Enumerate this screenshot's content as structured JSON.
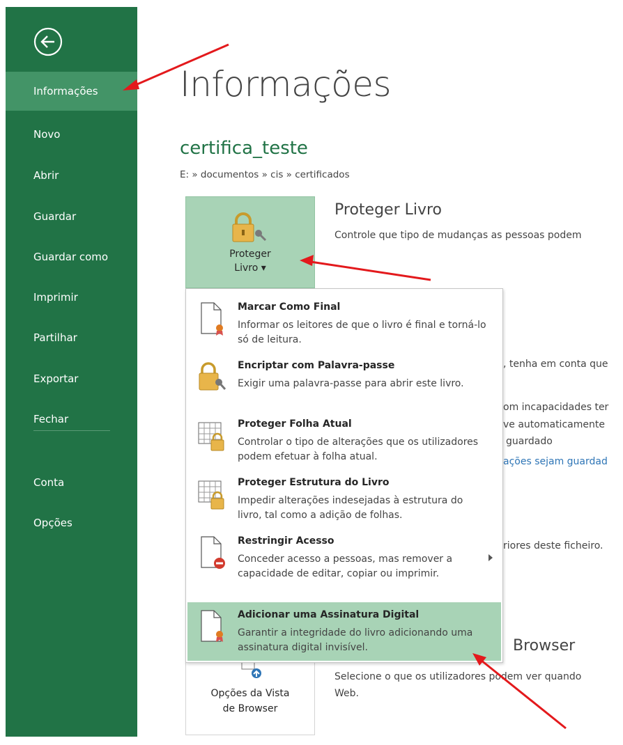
{
  "colors": {
    "sidebar": "#217346",
    "sidebar_selected": "#439467",
    "accent_green": "#217346",
    "highlight": "#a8d3b6",
    "link": "#2e75b6",
    "annotation_arrow": "#e3191c"
  },
  "sidebar": {
    "back_icon": "back-arrow-circle-icon",
    "items": [
      {
        "label": "Informações",
        "selected": true
      },
      {
        "label": "Novo"
      },
      {
        "label": "Abrir"
      },
      {
        "label": "Guardar"
      },
      {
        "label": "Guardar como"
      },
      {
        "label": "Imprimir"
      },
      {
        "label": "Partilhar"
      },
      {
        "label": "Exportar"
      },
      {
        "label": "Fechar"
      }
    ],
    "bottom_items": [
      {
        "label": "Conta"
      },
      {
        "label": "Opções"
      }
    ]
  },
  "main": {
    "page_title": "Informações",
    "document_title": "certifica_teste",
    "breadcrumb": "E: » documentos » cis » certificados",
    "protect_section": {
      "button_label_line1": "Proteger",
      "button_label_line2": "Livro ▾",
      "icon": "lock-key-icon",
      "heading": "Proteger Livro",
      "description": "Controle que tipo de mudanças as pessoas podem"
    },
    "background_fragments": [
      ", tenha em conta que",
      "om incapacidades ter",
      "ve automaticamente",
      "guardado",
      "ações sejam guardad",
      "riores deste ficheiro."
    ],
    "browser_section": {
      "button_label_line1": "Opções da Vista",
      "button_label_line2": "de Browser",
      "icon": "browser-view-options-icon",
      "heading": "Browser",
      "description_line1": "Selecione o que os utilizadores podem ver quando",
      "description_line2": "Web."
    }
  },
  "protect_menu": {
    "items": [
      {
        "title": "Marcar Como Final",
        "desc": "Informar os leitores de que o livro é final e torná-lo só de leitura.",
        "icon": "document-ribbon-icon"
      },
      {
        "title": "Encriptar com Palavra-passe",
        "desc": "Exigir uma palavra-passe para abrir este livro.",
        "icon": "lock-key-icon"
      },
      {
        "title": "Proteger Folha Atual",
        "desc": "Controlar o tipo de alterações que os utilizadores podem efetuar à folha atual.",
        "icon": "sheet-lock-icon"
      },
      {
        "title": "Proteger Estrutura do Livro",
        "desc": "Impedir alterações indesejadas à estrutura do livro, tal como a adição de folhas.",
        "icon": "sheet-lock-icon"
      },
      {
        "title": "Restringir Acesso",
        "desc": "Conceder acesso a pessoas, mas remover a capacidade de editar, copiar ou imprimir.",
        "icon": "document-restrict-icon",
        "has_submenu": true
      },
      {
        "title": "Adicionar uma Assinatura Digital",
        "desc": "Garantir a integridade do livro adicionando uma assinatura digital invisível.",
        "icon": "document-ribbon-icon",
        "highlighted": true
      }
    ]
  }
}
